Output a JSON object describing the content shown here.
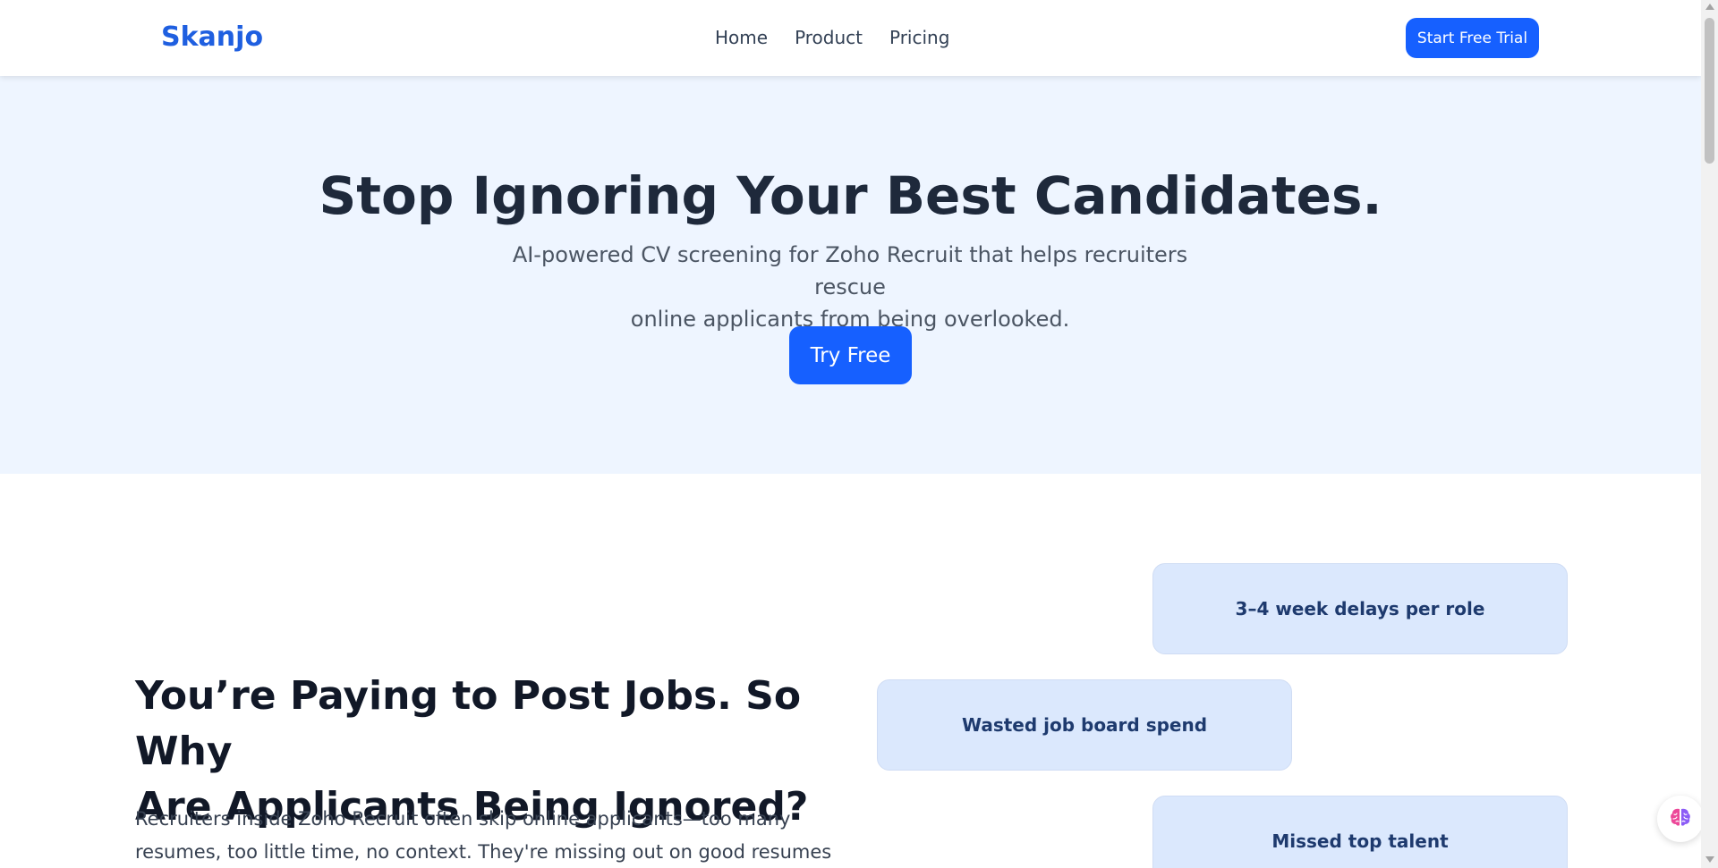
{
  "navbar": {
    "logo": "Skanjo",
    "links": [
      "Home",
      "Product",
      "Pricing"
    ],
    "cta_label": "Start Free Trial"
  },
  "hero": {
    "title": "Stop Ignoring Your Best Candidates.",
    "subtitle_line1": "AI-powered CV screening for Zoho Recruit that helps recruiters rescue",
    "subtitle_line2": "online applicants from being overlooked.",
    "cta_label": "Try Free"
  },
  "problem": {
    "title_line1": "You’re Paying to Post Jobs. So Why",
    "title_line2": "Are Applicants Being Ignored?",
    "body_line1": "Recruiters inside Zoho Recruit often skip online applicants—too many",
    "body_line2": "resumes, too little time, no context. They're missing out on good resumes just",
    "pain_points": [
      "3–4 week delays per role",
      "Wasted job board spend",
      "Missed top talent"
    ]
  },
  "widget": {
    "icon": "brain-icon"
  },
  "colors": {
    "brand": "#1660ff",
    "logo": "#1f5fe0",
    "hero_bg": "#eef5ff",
    "card_bg": "#dbe8fd"
  }
}
